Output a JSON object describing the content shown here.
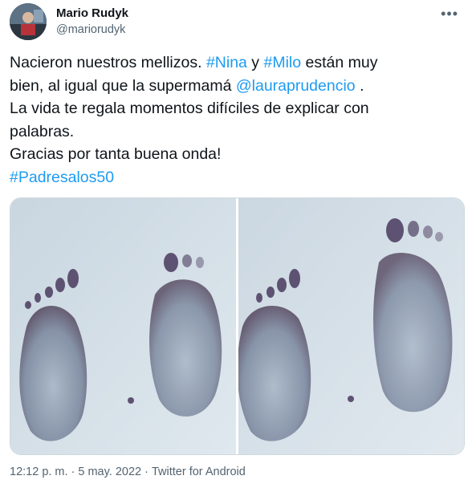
{
  "author": {
    "name": "Mario Rudyk",
    "handle": "@mariorudyk",
    "more_icon": "more-dots-icon"
  },
  "tweet": {
    "line1_prefix": "Nacieron nuestros mellizos. ",
    "tag_nina": "#Nina",
    "line1_mid": " y ",
    "tag_milo": "#Milo",
    "line1_suffix": " están muy",
    "line2_prefix": "bien, al igual que la supermamá ",
    "mention": "@lauraprudencio",
    "line2_suffix": " .",
    "line3": "La vida te regala momentos difíciles de explicar con",
    "line4": "palabras.",
    "line5": "Gracias por tanta buena onda!",
    "hashtag": "#Padresalos50"
  },
  "media": {
    "photos": [
      "footprints-photo-1",
      "footprints-photo-2"
    ]
  },
  "meta": {
    "time": "12:12 p. m.",
    "separator": "·",
    "date": "5 may. 2022",
    "source": "Twitter for Android"
  }
}
